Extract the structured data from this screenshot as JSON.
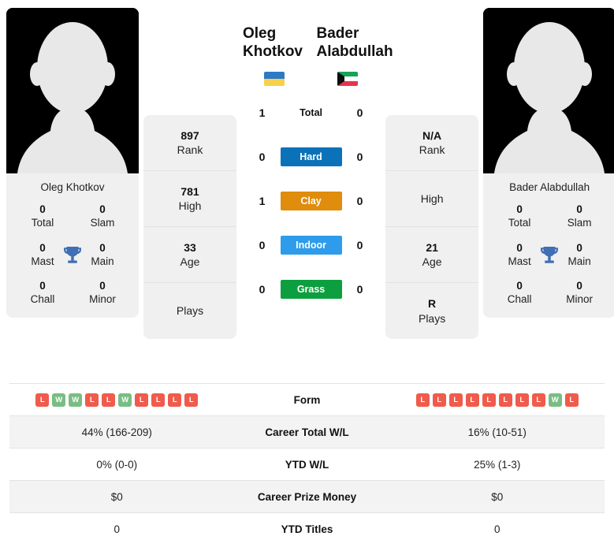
{
  "left_player": {
    "name": "Oleg Khotkov",
    "photo_caption": "Oleg Khotkov",
    "flag": "ukraine-flag",
    "trophies": [
      {
        "value": "0",
        "label": "Total"
      },
      {
        "value": "0",
        "label": "Slam"
      },
      {
        "value": "0",
        "label": "Mast"
      },
      {
        "value": "0",
        "label": "Main"
      },
      {
        "value": "0",
        "label": "Chall"
      },
      {
        "value": "0",
        "label": "Minor"
      }
    ],
    "ranks": [
      {
        "value": "897",
        "label": "Rank"
      },
      {
        "value": "781",
        "label": "High"
      },
      {
        "value": "33",
        "label": "Age"
      },
      {
        "value": "",
        "label": "Plays"
      }
    ],
    "form": [
      "L",
      "W",
      "W",
      "L",
      "L",
      "W",
      "L",
      "L",
      "L",
      "L"
    ],
    "career_total_wl": "44% (166-209)",
    "ytd_wl": "0% (0-0)",
    "career_prize_money": "$0",
    "ytd_titles": "0"
  },
  "right_player": {
    "name": "Bader Alabdullah",
    "photo_caption": "Bader Alabdullah",
    "flag": "kuwait-flag",
    "trophies": [
      {
        "value": "0",
        "label": "Total"
      },
      {
        "value": "0",
        "label": "Slam"
      },
      {
        "value": "0",
        "label": "Mast"
      },
      {
        "value": "0",
        "label": "Main"
      },
      {
        "value": "0",
        "label": "Chall"
      },
      {
        "value": "0",
        "label": "Minor"
      }
    ],
    "ranks": [
      {
        "value": "N/A",
        "label": "Rank"
      },
      {
        "value": "",
        "label": "High"
      },
      {
        "value": "21",
        "label": "Age"
      },
      {
        "value": "R",
        "label": "Plays"
      }
    ],
    "form": [
      "L",
      "L",
      "L",
      "L",
      "L",
      "L",
      "L",
      "L",
      "W",
      "L"
    ],
    "career_total_wl": "16% (10-51)",
    "ytd_wl": "25% (1-3)",
    "career_prize_money": "$0",
    "ytd_titles": "0"
  },
  "head_to_head": [
    {
      "surface": "Total",
      "left": "1",
      "right": "0",
      "color": "transparent"
    },
    {
      "surface": "Hard",
      "left": "0",
      "right": "0",
      "color": "#0b72ba"
    },
    {
      "surface": "Clay",
      "left": "1",
      "right": "0",
      "color": "#e08c0c"
    },
    {
      "surface": "Indoor",
      "left": "0",
      "right": "0",
      "color": "#2f9ceb"
    },
    {
      "surface": "Grass",
      "left": "0",
      "right": "0",
      "color": "#0d9f3f"
    }
  ],
  "table_rows": [
    {
      "label": "Form",
      "type": "form"
    },
    {
      "label": "Career Total W/L",
      "left": "44% (166-209)",
      "right": "16% (10-51)"
    },
    {
      "label": "YTD W/L",
      "left": "0% (0-0)",
      "right": "25% (1-3)"
    },
    {
      "label": "Career Prize Money",
      "left": "$0",
      "right": "$0"
    },
    {
      "label": "YTD Titles",
      "left": "0",
      "right": "0"
    }
  ],
  "colors": {
    "win_badge": "#79bd84",
    "loss_badge": "#ef5b4c",
    "trophy": "#3f6fb5",
    "card_bg": "#f0f0f0",
    "row_alt_bg": "#f3f3f3"
  }
}
